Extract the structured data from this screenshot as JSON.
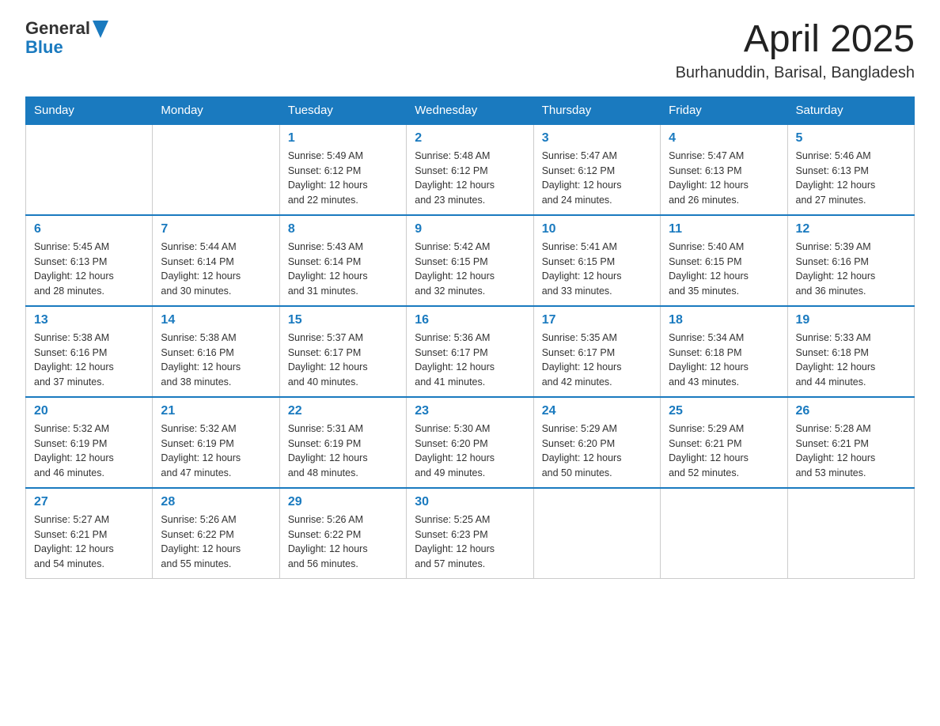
{
  "header": {
    "logo_general": "General",
    "logo_blue": "Blue",
    "month_year": "April 2025",
    "location": "Burhanuddin, Barisal, Bangladesh"
  },
  "weekdays": [
    "Sunday",
    "Monday",
    "Tuesday",
    "Wednesday",
    "Thursday",
    "Friday",
    "Saturday"
  ],
  "weeks": [
    [
      {
        "day": "",
        "info": ""
      },
      {
        "day": "",
        "info": ""
      },
      {
        "day": "1",
        "info": "Sunrise: 5:49 AM\nSunset: 6:12 PM\nDaylight: 12 hours\nand 22 minutes."
      },
      {
        "day": "2",
        "info": "Sunrise: 5:48 AM\nSunset: 6:12 PM\nDaylight: 12 hours\nand 23 minutes."
      },
      {
        "day": "3",
        "info": "Sunrise: 5:47 AM\nSunset: 6:12 PM\nDaylight: 12 hours\nand 24 minutes."
      },
      {
        "day": "4",
        "info": "Sunrise: 5:47 AM\nSunset: 6:13 PM\nDaylight: 12 hours\nand 26 minutes."
      },
      {
        "day": "5",
        "info": "Sunrise: 5:46 AM\nSunset: 6:13 PM\nDaylight: 12 hours\nand 27 minutes."
      }
    ],
    [
      {
        "day": "6",
        "info": "Sunrise: 5:45 AM\nSunset: 6:13 PM\nDaylight: 12 hours\nand 28 minutes."
      },
      {
        "day": "7",
        "info": "Sunrise: 5:44 AM\nSunset: 6:14 PM\nDaylight: 12 hours\nand 30 minutes."
      },
      {
        "day": "8",
        "info": "Sunrise: 5:43 AM\nSunset: 6:14 PM\nDaylight: 12 hours\nand 31 minutes."
      },
      {
        "day": "9",
        "info": "Sunrise: 5:42 AM\nSunset: 6:15 PM\nDaylight: 12 hours\nand 32 minutes."
      },
      {
        "day": "10",
        "info": "Sunrise: 5:41 AM\nSunset: 6:15 PM\nDaylight: 12 hours\nand 33 minutes."
      },
      {
        "day": "11",
        "info": "Sunrise: 5:40 AM\nSunset: 6:15 PM\nDaylight: 12 hours\nand 35 minutes."
      },
      {
        "day": "12",
        "info": "Sunrise: 5:39 AM\nSunset: 6:16 PM\nDaylight: 12 hours\nand 36 minutes."
      }
    ],
    [
      {
        "day": "13",
        "info": "Sunrise: 5:38 AM\nSunset: 6:16 PM\nDaylight: 12 hours\nand 37 minutes."
      },
      {
        "day": "14",
        "info": "Sunrise: 5:38 AM\nSunset: 6:16 PM\nDaylight: 12 hours\nand 38 minutes."
      },
      {
        "day": "15",
        "info": "Sunrise: 5:37 AM\nSunset: 6:17 PM\nDaylight: 12 hours\nand 40 minutes."
      },
      {
        "day": "16",
        "info": "Sunrise: 5:36 AM\nSunset: 6:17 PM\nDaylight: 12 hours\nand 41 minutes."
      },
      {
        "day": "17",
        "info": "Sunrise: 5:35 AM\nSunset: 6:17 PM\nDaylight: 12 hours\nand 42 minutes."
      },
      {
        "day": "18",
        "info": "Sunrise: 5:34 AM\nSunset: 6:18 PM\nDaylight: 12 hours\nand 43 minutes."
      },
      {
        "day": "19",
        "info": "Sunrise: 5:33 AM\nSunset: 6:18 PM\nDaylight: 12 hours\nand 44 minutes."
      }
    ],
    [
      {
        "day": "20",
        "info": "Sunrise: 5:32 AM\nSunset: 6:19 PM\nDaylight: 12 hours\nand 46 minutes."
      },
      {
        "day": "21",
        "info": "Sunrise: 5:32 AM\nSunset: 6:19 PM\nDaylight: 12 hours\nand 47 minutes."
      },
      {
        "day": "22",
        "info": "Sunrise: 5:31 AM\nSunset: 6:19 PM\nDaylight: 12 hours\nand 48 minutes."
      },
      {
        "day": "23",
        "info": "Sunrise: 5:30 AM\nSunset: 6:20 PM\nDaylight: 12 hours\nand 49 minutes."
      },
      {
        "day": "24",
        "info": "Sunrise: 5:29 AM\nSunset: 6:20 PM\nDaylight: 12 hours\nand 50 minutes."
      },
      {
        "day": "25",
        "info": "Sunrise: 5:29 AM\nSunset: 6:21 PM\nDaylight: 12 hours\nand 52 minutes."
      },
      {
        "day": "26",
        "info": "Sunrise: 5:28 AM\nSunset: 6:21 PM\nDaylight: 12 hours\nand 53 minutes."
      }
    ],
    [
      {
        "day": "27",
        "info": "Sunrise: 5:27 AM\nSunset: 6:21 PM\nDaylight: 12 hours\nand 54 minutes."
      },
      {
        "day": "28",
        "info": "Sunrise: 5:26 AM\nSunset: 6:22 PM\nDaylight: 12 hours\nand 55 minutes."
      },
      {
        "day": "29",
        "info": "Sunrise: 5:26 AM\nSunset: 6:22 PM\nDaylight: 12 hours\nand 56 minutes."
      },
      {
        "day": "30",
        "info": "Sunrise: 5:25 AM\nSunset: 6:23 PM\nDaylight: 12 hours\nand 57 minutes."
      },
      {
        "day": "",
        "info": ""
      },
      {
        "day": "",
        "info": ""
      },
      {
        "day": "",
        "info": ""
      }
    ]
  ]
}
